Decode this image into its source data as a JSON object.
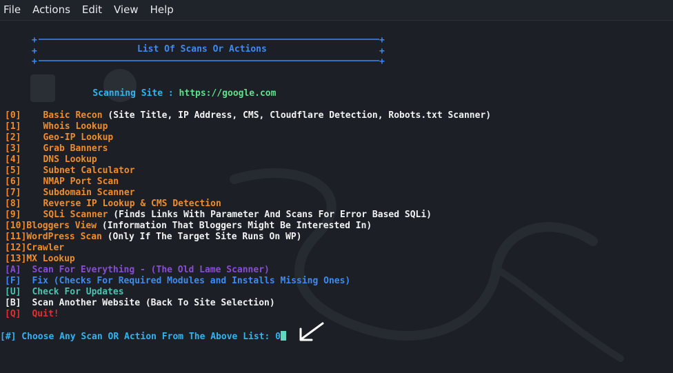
{
  "menu": {
    "items": [
      "File",
      "Actions",
      "Edit",
      "View",
      "Help"
    ]
  },
  "banner": {
    "border_top": "+==========================================================+",
    "title_line": "+                   List Of Scans Or Actions                 +",
    "border_bottom": "+==========================================================+",
    "border_top_display": "+ ------------------------------------------------------------ +",
    "title": "List Of Scans Or Actions"
  },
  "scanning": {
    "label": "Scanning Site : ",
    "site": "https://google.com"
  },
  "options": [
    {
      "key": "[0]",
      "name": "Basic Recon",
      "desc": " (Site Title, IP Address, CMS, Cloudflare Detection, Robots.txt Scanner)"
    },
    {
      "key": "[1]",
      "name": "Whois Lookup",
      "desc": ""
    },
    {
      "key": "[2]",
      "name": "Geo-IP Lookup",
      "desc": ""
    },
    {
      "key": "[3]",
      "name": "Grab Banners",
      "desc": ""
    },
    {
      "key": "[4]",
      "name": "DNS Lookup",
      "desc": ""
    },
    {
      "key": "[5]",
      "name": "Subnet Calculator",
      "desc": ""
    },
    {
      "key": "[6]",
      "name": "NMAP Port Scan",
      "desc": ""
    },
    {
      "key": "[7]",
      "name": "Subdomain Scanner",
      "desc": ""
    },
    {
      "key": "[8]",
      "name": "Reverse IP Lookup & CMS Detection",
      "desc": ""
    },
    {
      "key": "[9]",
      "name": "SQLi Scanner",
      "desc": " (Finds Links With Parameter And Scans For Error Based SQLi)"
    },
    {
      "key": "[10]",
      "name": "Bloggers View",
      "desc": " (Information That Bloggers Might Be Interested In)"
    },
    {
      "key": "[11]",
      "name": "WordPress Scan",
      "desc": " (Only If The Target Site Runs On WP)"
    },
    {
      "key": "[12]",
      "name": "Crawler",
      "desc": ""
    },
    {
      "key": "[13]",
      "name": "MX Lookup",
      "desc": ""
    }
  ],
  "actions": {
    "a": {
      "key": "[A]",
      "text": "Scan For Everything - (The Old Lame Scanner)"
    },
    "f": {
      "key": "[F]",
      "text": "Fix (Checks For Required Modules and Installs Missing Ones)"
    },
    "u": {
      "key": "[U]",
      "text": "Check For Updates"
    },
    "b": {
      "key": "[B]",
      "text": "Scan Another Website (Back To Site Selection)"
    },
    "q": {
      "key": "[Q]",
      "text": "Quit!"
    }
  },
  "prompt": {
    "text": "[#] Choose Any Scan OR Action From The Above List: ",
    "input_value": "0"
  },
  "colors": {
    "background": "#1c2026",
    "orange": "#f08c2c",
    "blue": "#3d8bf2",
    "green": "#5fe08a",
    "purple": "#8a4cd6",
    "red": "#e03030",
    "teal": "#4cc2b0"
  },
  "icons": {
    "annotation_arrow": "arrow-icon"
  }
}
